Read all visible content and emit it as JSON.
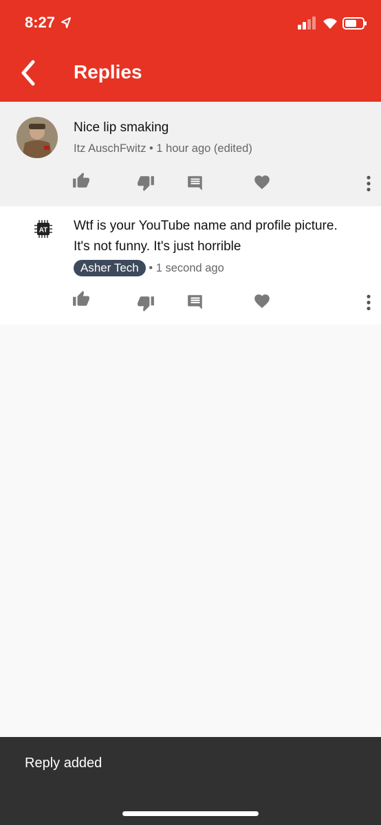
{
  "status_bar": {
    "time": "8:27"
  },
  "header": {
    "title": "Replies"
  },
  "comments": [
    {
      "text": "Nice lip smaking",
      "author": "Itz AuschFwitz",
      "time": "1 hour ago (edited)"
    },
    {
      "text_line1": "Wtf is your YouTube name and profile picture.",
      "text_line2": "It's not funny. It's just horrible",
      "author": "Asher Tech",
      "time": "1 second ago",
      "avatar_initials": "AT"
    }
  ],
  "snackbar": {
    "message": "Reply added"
  },
  "colors": {
    "header": "#e63323",
    "chip": "#3d4a5c",
    "snackbar": "#313131",
    "icon": "#7a7a7a"
  }
}
